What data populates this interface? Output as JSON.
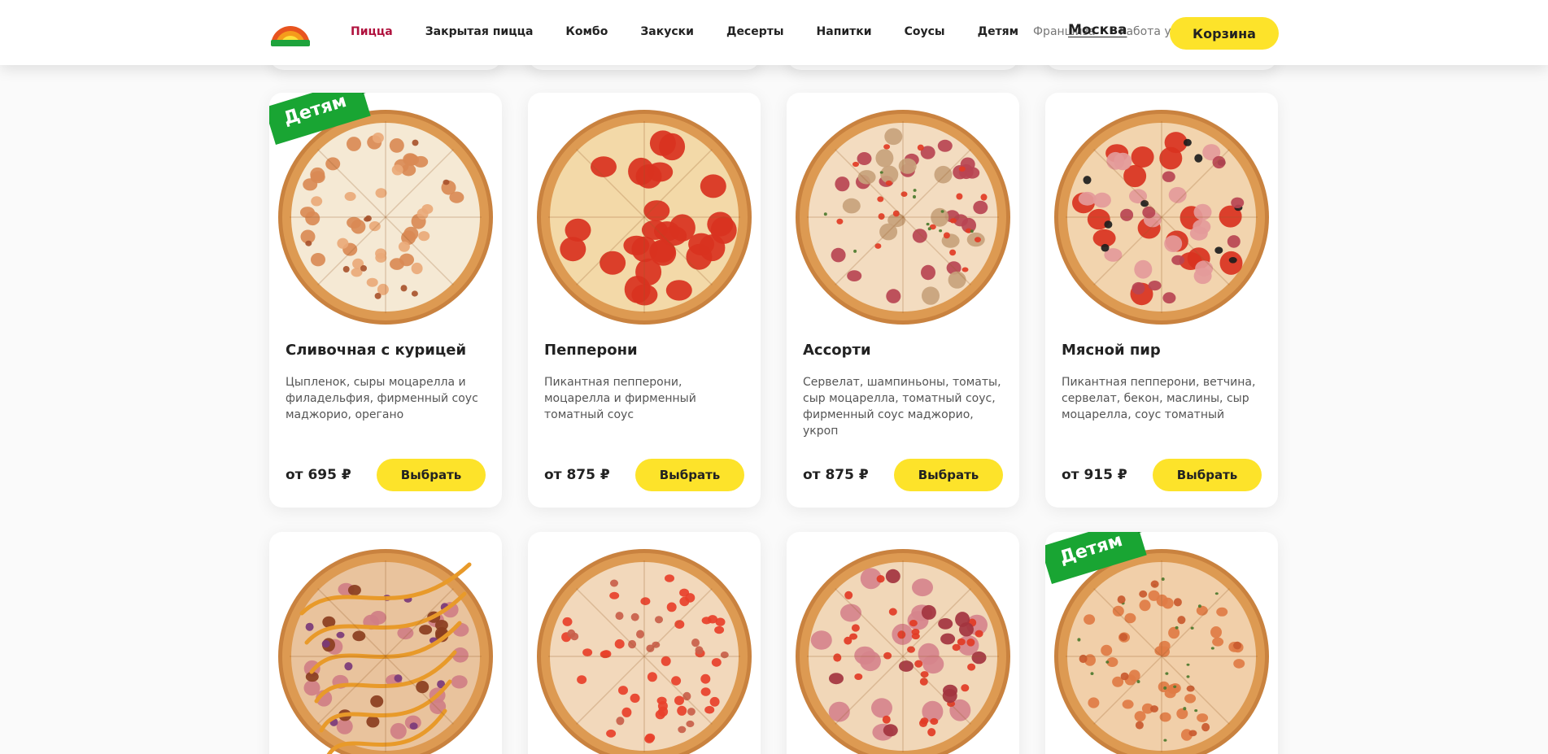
{
  "header": {
    "nav": [
      "Пицца",
      "Закрытая пицца",
      "Комбо",
      "Закуски",
      "Десерты",
      "Напитки",
      "Соусы",
      "Детям"
    ],
    "active_nav": "Пицца",
    "franchise": "Франшиза",
    "city": "Москва",
    "work": "Работа у нас",
    "cart_label": "Корзина"
  },
  "colors": {
    "accent_yellow": "#fde32a",
    "active_nav": "#b0123e",
    "kids_green": "#19a533"
  },
  "badge_label": "Детям",
  "choose_label": "Выбрать",
  "products": [
    {
      "title": "Сливочная с курицей",
      "desc": "Цыпленок, сыры моцарелла и филадельфия, фирменный соус маджорио, орегано",
      "price": "от 695 ₽",
      "kids": true,
      "style": "chicken"
    },
    {
      "title": "Пепперони",
      "desc": "Пикантная пепперони, моцарелла и фирменный томатный соус",
      "price": "от 875 ₽",
      "kids": false,
      "style": "pepperoni"
    },
    {
      "title": "Ассорти",
      "desc": "Сервелат, шампиньоны, томаты, сыр моцарелла, томатный соус, фирменный соус маджорио, укроп",
      "price": "от 875 ₽",
      "kids": false,
      "style": "assorti"
    },
    {
      "title": "Мясной пир",
      "desc": "Пикантная пепперони, ветчина, сервелат, бекон, маслины, сыр моцарелла, соус томатный",
      "price": "от 915 ₽",
      "kids": false,
      "style": "meat"
    },
    {
      "title": "",
      "desc": "",
      "price": "",
      "kids": false,
      "style": "bbq"
    },
    {
      "title": "",
      "desc": "",
      "price": "",
      "kids": false,
      "style": "tomato"
    },
    {
      "title": "",
      "desc": "",
      "price": "",
      "kids": false,
      "style": "ham"
    },
    {
      "title": "",
      "desc": "",
      "price": "",
      "kids": true,
      "style": "chicken2"
    }
  ]
}
